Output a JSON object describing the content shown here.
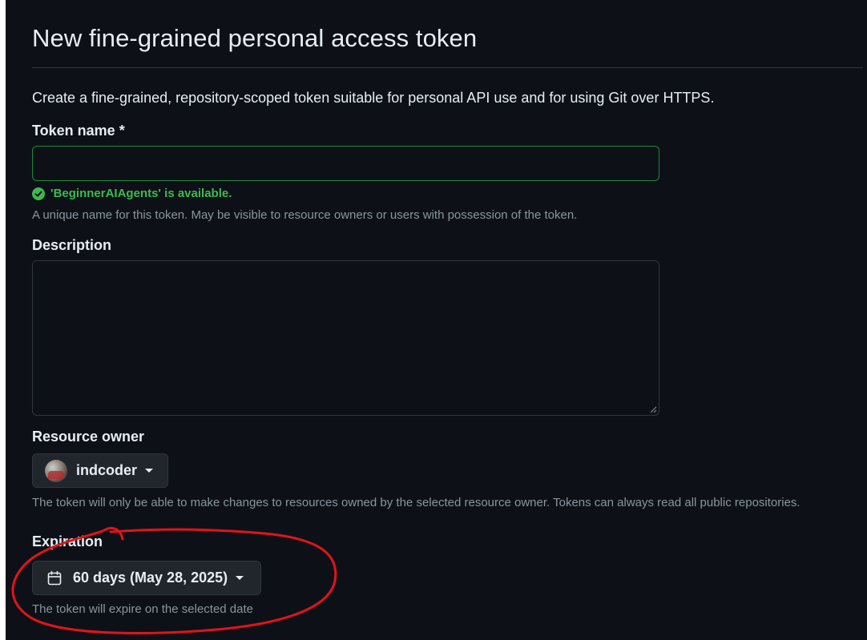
{
  "page": {
    "title": "New fine-grained personal access token",
    "intro": "Create a fine-grained, repository-scoped token suitable for personal API use and for using Git over HTTPS."
  },
  "token_name": {
    "label": "Token name *",
    "value": "",
    "validation": "'BeginnerAIAgents' is available.",
    "help": "A unique name for this token. May be visible to resource owners or users with possession of the token."
  },
  "description": {
    "label": "Description",
    "value": ""
  },
  "resource_owner": {
    "label": "Resource owner",
    "selected": "indcoder",
    "help": "The token will only be able to make changes to resources owned by the selected resource owner. Tokens can always read all public repositories."
  },
  "expiration": {
    "label": "Expiration",
    "selected": "60 days (May 28, 2025)",
    "help": "The token will expire on the selected date"
  },
  "colors": {
    "background": "#0d1117",
    "success": "#3fb950",
    "input_valid_border": "#238636",
    "annotation": "#e0141a"
  },
  "icons": {
    "validation": "check-circle-icon",
    "expiration": "calendar-icon",
    "dropdown": "triangle-down-icon"
  }
}
